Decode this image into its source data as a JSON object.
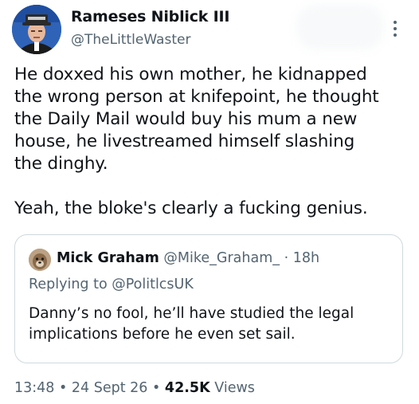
{
  "author": {
    "name": "Rameses Niblick III",
    "handle": "@TheLittleWaster"
  },
  "tweet_text": "He doxxed his own mother, he kidnapped\nthe wrong person at knifepoint, he thought\nthe Daily Mail would buy his mum a new\nhouse, he livestreamed himself slashing\nthe dinghy.\n\nYeah, the bloke's clearly a fucking genius.",
  "quote": {
    "name": "Mick Graham",
    "handle": "@Mike_Graham_",
    "separator": "·",
    "time": "18h",
    "replying_to": "Replying to @PolitlcsUK",
    "text": "Danny’s no fool,  he’ll have studied the legal\nimplications before he even set sail."
  },
  "meta": {
    "time": "13:48",
    "date": "24 Sept 26",
    "separator": "•",
    "views_count": "42.5K",
    "views_label": "Views"
  },
  "icons": {
    "more": "more-options-icon",
    "author_avatar": "avatar",
    "quote_avatar": "avatar"
  },
  "colors": {
    "text": "#0f1419",
    "secondary": "#536471",
    "border": "#cfd9de"
  }
}
